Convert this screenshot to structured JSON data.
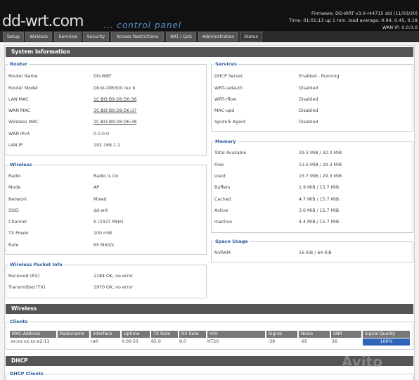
{
  "header": {
    "logo": "dd-wrt.com",
    "tagline": "... control panel",
    "firmware": "Firmware: DD-WRT v3.0-r44715 std (11/03/20)",
    "time": "Time: 01:01:13 up 1 min, load average: 0.94, 0.45, 0.18",
    "wan_ip": "WAN IP: 0.0.0.0"
  },
  "tabs": [
    "Setup",
    "Wireless",
    "Services",
    "Security",
    "Access Restrictions",
    "NAT / QoS",
    "Administration",
    "Status"
  ],
  "system_info": {
    "title": "System Information",
    "router": {
      "legend": "Router",
      "rows": [
        {
          "label": "Router Name",
          "value": "DD-WRT"
        },
        {
          "label": "Router Model",
          "value": "Dlink-DIR300 rev b"
        },
        {
          "label": "LAN MAC",
          "value": "1C:BD:B9:28:D6:36"
        },
        {
          "label": "WAN MAC",
          "value": "1C:BD:B9:28:D6:37"
        },
        {
          "label": "Wireless MAC",
          "value": "1C:BD:B9:28:D6:38"
        },
        {
          "label": "WAN IPv4",
          "value": "0.0.0.0"
        },
        {
          "label": "LAN IP",
          "value": "192.168.1.1"
        }
      ]
    },
    "services": {
      "legend": "Services",
      "rows": [
        {
          "label": "DHCP Server",
          "value": "Enabled - Running"
        },
        {
          "label": "WRT-radauth",
          "value": "Disabled"
        },
        {
          "label": "WRT-rflow",
          "value": "Disabled"
        },
        {
          "label": "MAC-upd",
          "value": "Disabled"
        },
        {
          "label": "Sputnik Agent",
          "value": "Disabled"
        }
      ]
    },
    "memory": {
      "legend": "Memory",
      "rows": [
        {
          "label": "Total Available",
          "value": "29.3 MiB / 32.0 MiB"
        },
        {
          "label": "Free",
          "value": "13.6 MiB / 29.3 MiB"
        },
        {
          "label": "Used",
          "value": "15.7 MiB / 29.3 MiB"
        },
        {
          "label": "Buffers",
          "value": "1.9 MiB / 15.7 MiB"
        },
        {
          "label": "Cached",
          "value": "4.7 MiB / 15.7 MiB"
        },
        {
          "label": "Active",
          "value": "3.0 MiB / 15.7 MiB"
        },
        {
          "label": "Inactive",
          "value": "4.4 MiB / 15.7 MiB"
        }
      ]
    },
    "wireless": {
      "legend": "Wireless",
      "rows": [
        {
          "label": "Radio",
          "value": "Radio is On"
        },
        {
          "label": "Mode",
          "value": "AP"
        },
        {
          "label": "Network",
          "value": "Mixed"
        },
        {
          "label": "SSID",
          "value": "dd-wrt"
        },
        {
          "label": "Channel",
          "value": "6 (2437 MHz)"
        },
        {
          "label": "TX Power",
          "value": "100 mW"
        },
        {
          "label": "Rate",
          "value": "65 Mbit/s"
        }
      ]
    },
    "space": {
      "legend": "Space Usage",
      "rows": [
        {
          "label": "NVRAM",
          "value": "16 KiB / 64 KiB"
        }
      ]
    },
    "packets": {
      "legend": "Wireless Packet Info",
      "rows": [
        {
          "label": "Received (RX)",
          "value": "2184 OK, no error"
        },
        {
          "label": "Transmitted (TX)",
          "value": "1970 OK, no error"
        }
      ]
    }
  },
  "wireless_section": {
    "title": "Wireless",
    "clients_legend": "Clients",
    "columns": [
      "MAC Address",
      "Radioname",
      "Interface",
      "Uptime",
      "TX Rate",
      "RX Rate",
      "Info",
      "Signal",
      "Noise",
      "SNR",
      "Signal Quality"
    ],
    "row": [
      "xx:xx:xx:xx:e2:11",
      "",
      "ra0",
      "0:00:53",
      "65.0",
      "6.0",
      "HT20",
      "-39",
      "-95",
      "56",
      "100%"
    ],
    "signal_quality_fraction": 1.0
  },
  "dhcp_section": {
    "title": "DHCP",
    "clients_legend": "DHCP Clients"
  },
  "watermark": "Avito"
}
